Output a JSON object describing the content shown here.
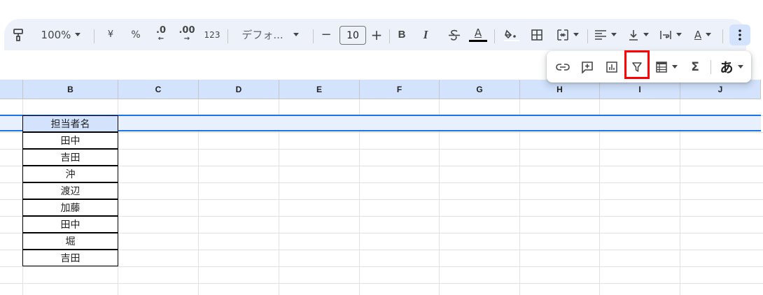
{
  "toolbar": {
    "zoom": "100%",
    "currency": "¥",
    "percent": "%",
    "decrease_decimal": ".0",
    "increase_decimal": ".00",
    "number_format": "123",
    "font_name": "デフォ...",
    "font_size": "10",
    "minus": "−",
    "plus": "+",
    "bold": "B",
    "italic": "I",
    "text_color_letter": "A",
    "align_label": "A"
  },
  "popup": {
    "sum": "Σ",
    "input_method": "あ"
  },
  "columns": [
    "B",
    "C",
    "D",
    "E",
    "F",
    "G",
    "H",
    "I",
    "J"
  ],
  "table": {
    "header": "担当者名",
    "rows": [
      "田中",
      "吉田",
      "沖",
      "渡辺",
      "加藤",
      "田中",
      "堀",
      "吉田"
    ]
  },
  "colors": {
    "toolbar_bg": "#edf2fa",
    "column_header_bg": "#d3e3fd",
    "selection_border": "#1a73e8",
    "highlight_border": "#ff0000"
  }
}
